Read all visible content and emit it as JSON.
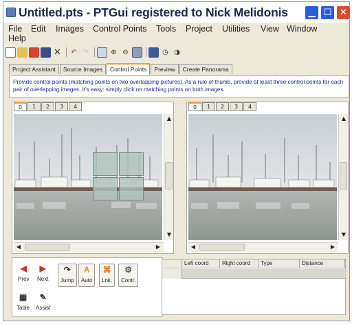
{
  "window": {
    "title": "Untitled.pts - PTGui registered to Nick Melidonis"
  },
  "menu": [
    "File",
    "Edit",
    "Images",
    "Control Points",
    "Tools",
    "Project",
    "Utilities",
    "View",
    "Window",
    "Help"
  ],
  "toolbar": [
    "new-icon",
    "open-icon",
    "open-dropdown-icon",
    "save-icon",
    "delete-icon",
    "undo-icon",
    "redo-icon",
    "image-icon",
    "zoom-in-icon",
    "zoom-out-icon",
    "fit-icon",
    "panel-icon",
    "help-icon",
    "info-icon"
  ],
  "tabs": [
    "Project Assistant",
    "Source Images",
    "Control Points",
    "Preview",
    "Create Panorama"
  ],
  "active_tab": "Control Points",
  "instructions": "Provide control points (matching points on two overlapping pictures). As a rule of thumb, provide at least three control points for each pair of overlapping images. It's easy: simply click on matching points on both images.",
  "left_image_tabs": [
    "0",
    "1",
    "2",
    "3",
    "4"
  ],
  "right_image_tabs": [
    "0",
    "1",
    "2",
    "3",
    "4"
  ],
  "buttons": {
    "prev": "Prev",
    "next": "Next",
    "jump": "Jump",
    "auto": "Auto",
    "link": "Lnk.",
    "contr": "Contr.",
    "table": "Table",
    "assist": "Assist"
  },
  "table_columns": [
    "Left coord",
    "Right coord",
    "Type",
    "Distance"
  ],
  "colors": {
    "accent": "#f0a030",
    "instruction_text": "#1a2a8a",
    "close": "#d3502e"
  }
}
